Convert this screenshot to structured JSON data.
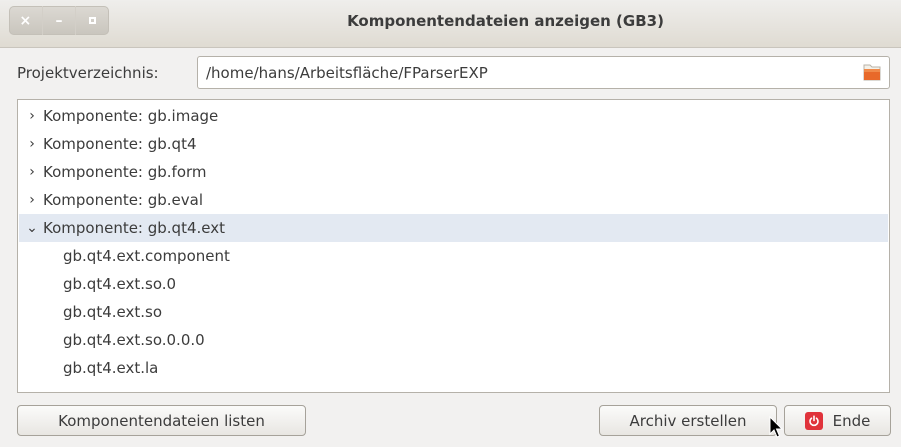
{
  "window": {
    "title": "Komponentendateien anzeigen (GB3)",
    "buttons": {
      "close": "×",
      "minimize": "–"
    }
  },
  "project": {
    "label": "Projektverzeichnis:",
    "path": "/home/hans/Arbeitsfläche/FParserEXP"
  },
  "tree": {
    "items": [
      {
        "label": "Komponente: gb.image",
        "expanded": false
      },
      {
        "label": "Komponente: gb.qt4",
        "expanded": false
      },
      {
        "label": "Komponente: gb.form",
        "expanded": false
      },
      {
        "label": "Komponente: gb.eval",
        "expanded": false
      },
      {
        "label": "Komponente: gb.qt4.ext",
        "expanded": true,
        "selected": true
      }
    ],
    "children": [
      "gb.qt4.ext.component",
      "gb.qt4.ext.so.0",
      "gb.qt4.ext.so",
      "gb.qt4.ext.so.0.0.0",
      "gb.qt4.ext.la"
    ]
  },
  "footer": {
    "list_label": "Komponentendateien listen",
    "archiv_label": "Archiv erstellen",
    "ende_label": "Ende"
  },
  "colors": {
    "selection": "#e3e9f2",
    "power_icon": "#e0333b",
    "folder_icon": "#e8692a"
  },
  "icons": {
    "expand_collapsed": "›",
    "expand_expanded": "⌄",
    "folder": "folder-icon",
    "power": "power-icon"
  }
}
